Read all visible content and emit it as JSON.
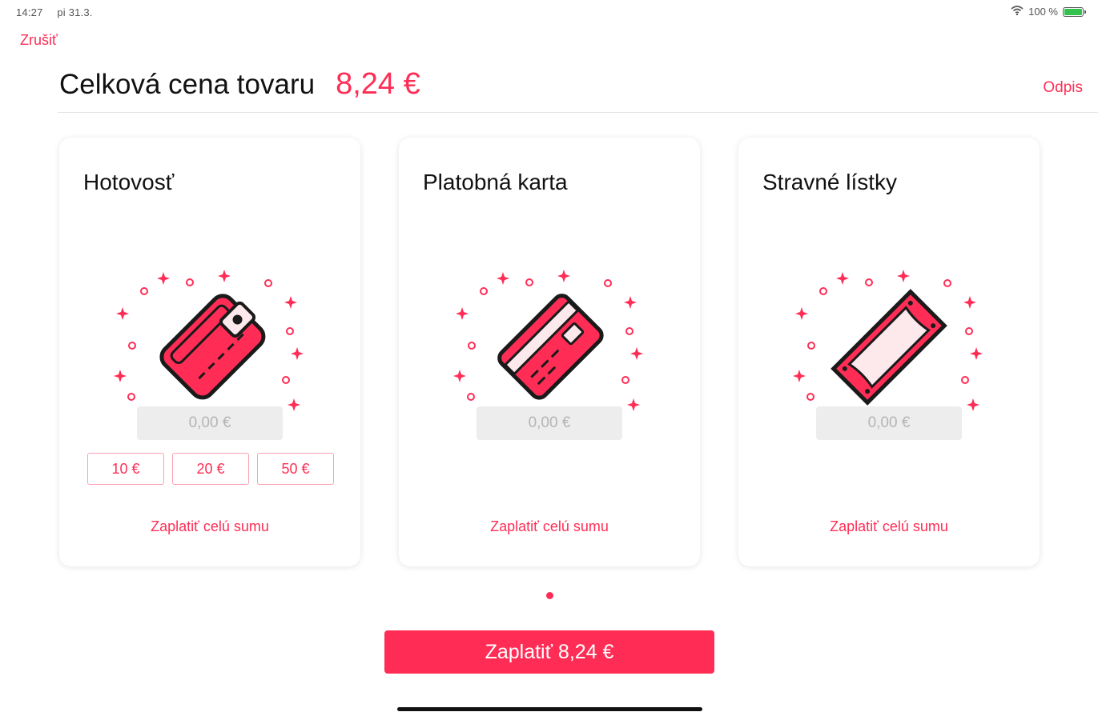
{
  "status_bar": {
    "time": "14:27",
    "date": "pi 31.3.",
    "battery_text": "100 %",
    "icons": [
      "wifi-icon",
      "battery-icon"
    ]
  },
  "nav": {
    "cancel_label": "Zrušiť",
    "writeoff_label": "Odpis"
  },
  "header": {
    "title": "Celková cena tovaru",
    "total": "8,24 €"
  },
  "cards": [
    {
      "title": "Hotovosť",
      "icon": "wallet-icon",
      "amount_placeholder": "0,00 €",
      "quick_amounts": [
        "10 €",
        "20 €",
        "50 €"
      ],
      "pay_full_label": "Zaplatiť celú sumu"
    },
    {
      "title": "Platobná karta",
      "icon": "credit-card-icon",
      "amount_placeholder": "0,00 €",
      "pay_full_label": "Zaplatiť celú sumu"
    },
    {
      "title": "Stravné lístky",
      "icon": "meal-voucher-icon",
      "amount_placeholder": "0,00 €",
      "pay_full_label": "Zaplatiť celú sumu"
    }
  ],
  "pay_button_label": "Zaplatiť 8,24 €",
  "colors": {
    "accent": "#ff2d55",
    "input_bg": "#ededed",
    "dark_outline": "#1a1a1a",
    "light_fill": "#fde8ec"
  }
}
